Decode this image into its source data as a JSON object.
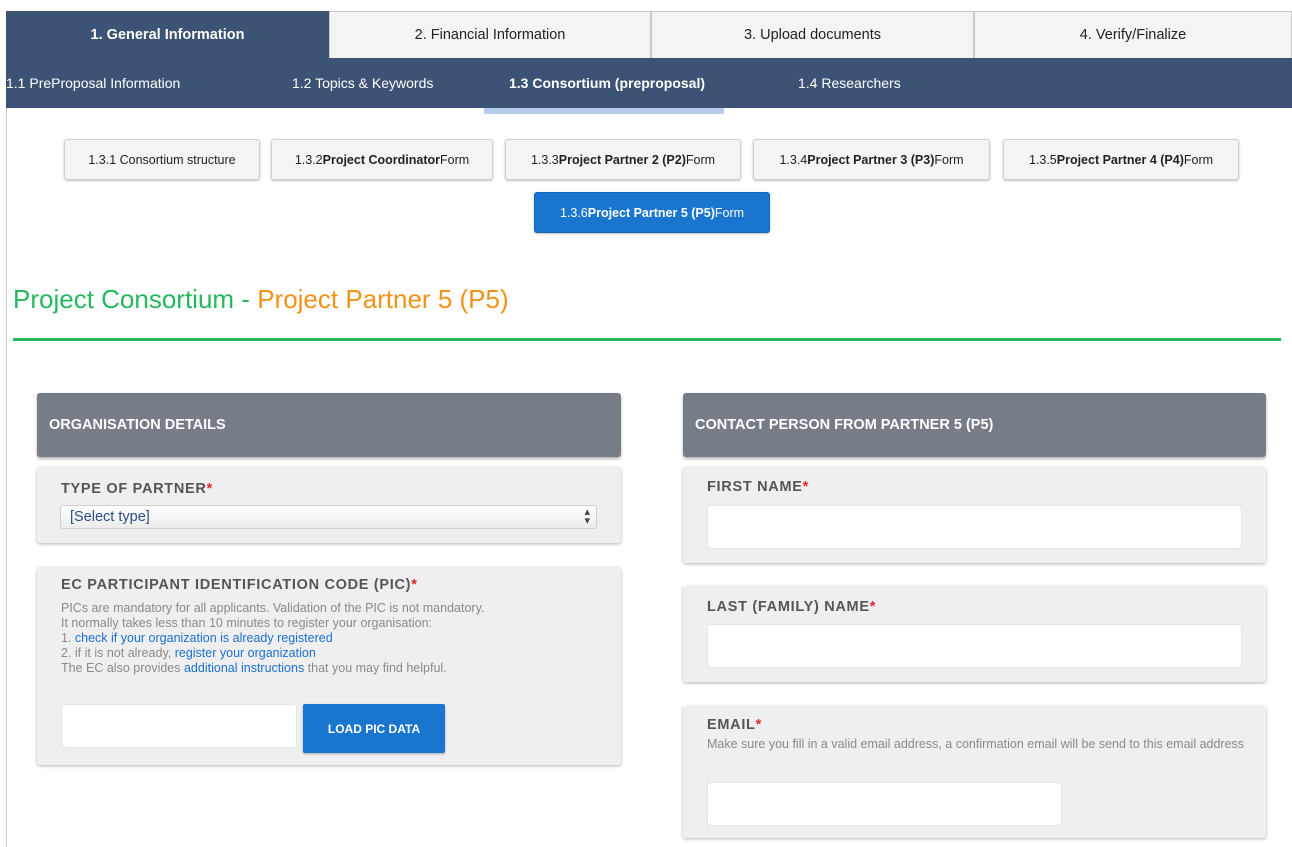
{
  "main_tabs": [
    {
      "label": "1. General Information",
      "active": true
    },
    {
      "label": "2. Financial Information",
      "active": false
    },
    {
      "label": "3. Upload documents",
      "active": false
    },
    {
      "label": "4. Verify/Finalize",
      "active": false
    }
  ],
  "sub_nav": [
    {
      "label": "1.1 PreProposal Information",
      "active": false
    },
    {
      "label": "1.2 Topics & Keywords",
      "active": false
    },
    {
      "label": "1.3 Consortium (preproposal)",
      "active": true
    },
    {
      "label": "1.4 Researchers",
      "active": false
    }
  ],
  "sub_tabs": [
    {
      "prefix": "1.3.1 Consortium structure",
      "bold": "",
      "suffix": "",
      "active": false
    },
    {
      "prefix": "1.3.2 ",
      "bold": "Project Coordinator",
      "suffix": " Form",
      "active": false
    },
    {
      "prefix": "1.3.3 ",
      "bold": "Project Partner 2 (P2)",
      "suffix": " Form",
      "active": false
    },
    {
      "prefix": "1.3.4 ",
      "bold": "Project Partner 3 (P3)",
      "suffix": " Form",
      "active": false
    },
    {
      "prefix": "1.3.5 ",
      "bold": "Project Partner 4 (P4)",
      "suffix": " Form",
      "active": false
    },
    {
      "prefix": "1.3.6 ",
      "bold": "Project Partner 5 (P5)",
      "suffix": " Form",
      "active": true
    }
  ],
  "title": {
    "green": "Project Consortium - ",
    "orange": "Project Partner 5 (P5)"
  },
  "colors": {
    "nav": "#3d5375",
    "accent_blue": "#1a75cf",
    "title_green": "#25b85d",
    "title_orange": "#f39219",
    "panel_header": "#767d86",
    "required": "#e0262b"
  },
  "org": {
    "header": "ORGANISATION DETAILS",
    "type_label": "TYPE OF PARTNER",
    "type_value": "[Select type]",
    "pic_label": "EC PARTICIPANT IDENTIFICATION CODE (PIC)",
    "help": {
      "line1": "PICs are mandatory for all applicants. Validation of the PIC is not mandatory.",
      "line2": "It normally takes less than 10 minutes to register your organisation:",
      "line3_prefix": "1. ",
      "line3_link": "check if your organization is already registered",
      "line4_prefix": "2. if it is not already, ",
      "line4_link": "register your organization",
      "line5_prefix": "The EC also provides ",
      "line5_link": "additional instructions",
      "line5_suffix": " that you may find helpful."
    },
    "pic_value": "",
    "load_button": "LOAD PIC DATA"
  },
  "contact": {
    "header": "CONTACT PERSON FROM PARTNER 5 (P5)",
    "first_name_label": "FIRST NAME",
    "first_name_value": "",
    "last_name_label": "LAST (FAMILY) NAME",
    "last_name_value": "",
    "email_label": "EMAIL",
    "email_help": "Make sure you fill in a valid email address, a confirmation email will be send to this email address",
    "email_value": ""
  },
  "required_marker": "*"
}
